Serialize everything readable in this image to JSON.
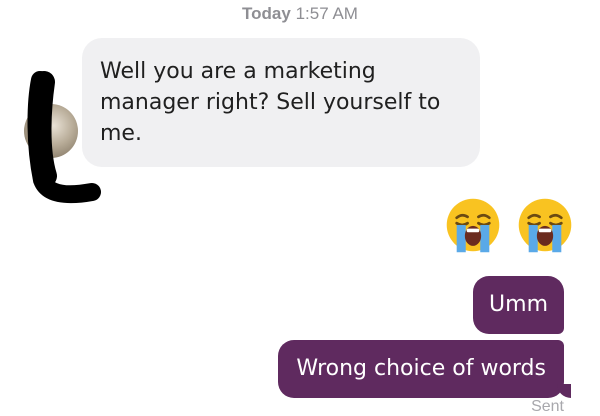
{
  "header": {
    "day": "Today",
    "time": "1:57 AM"
  },
  "incoming": {
    "text": "Well you are a marketing manager right? Sell yourself to me.",
    "avatar_icon": "profile-photo"
  },
  "emojis": [
    "loudly-crying-face",
    "loudly-crying-face"
  ],
  "outgoing": [
    {
      "text": "Umm"
    },
    {
      "text": "Wrong choice of words"
    }
  ],
  "status": "Sent",
  "colors": {
    "incoming_bubble": "#f0f0f2",
    "outgoing_bubble": "#5f2a5f",
    "timestamp": "#8e8e93",
    "redaction": "#000000",
    "emoji_face": "#f9c321",
    "emoji_tears": "#5aa9e8"
  }
}
